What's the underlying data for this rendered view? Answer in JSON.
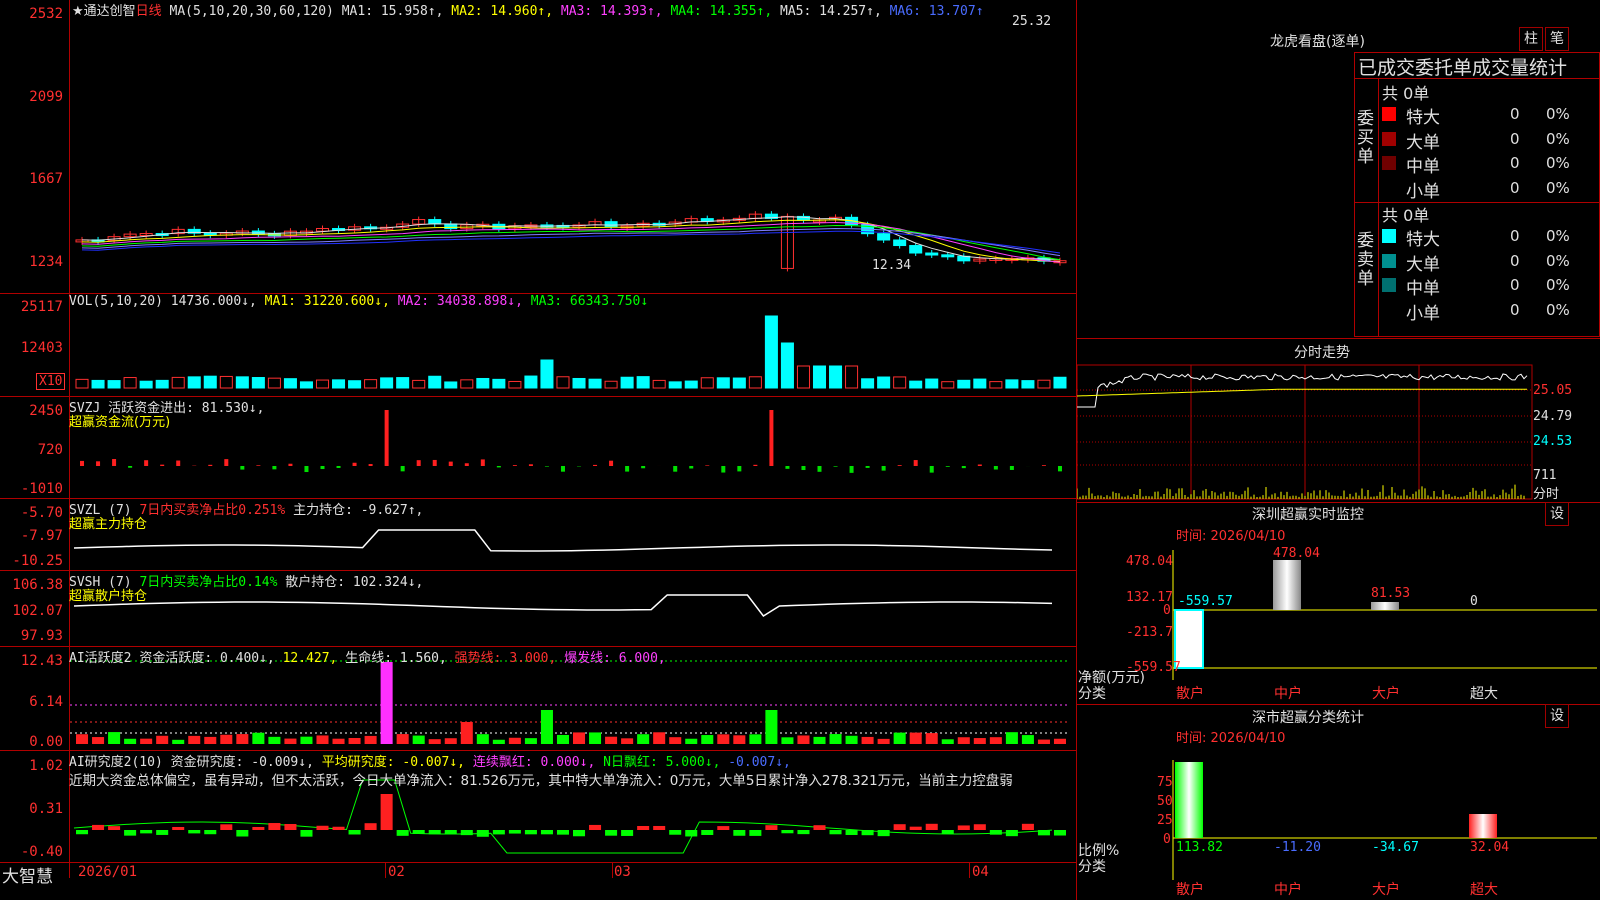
{
  "main": {
    "stock_name": "通达创智",
    "period": "日线",
    "ma_params": "MA(5,10,20,30,60,120)",
    "ma1": "MA1: 15.958↑,",
    "ma2": "MA2: 14.960↑,",
    "ma3": "MA3: 14.393↑,",
    "ma4": "MA4: 14.355↑,",
    "ma5": "MA5: 14.257↑,",
    "ma6": "MA6: 13.707↑",
    "high_label": "25.32",
    "low_label": "12.34",
    "y_ticks": [
      "2532",
      "2099",
      "1667",
      "1234"
    ]
  },
  "vol": {
    "title": "VOL(5,10,20)",
    "value": "14736.000↓,",
    "ma1": "MA1: 31220.600↓,",
    "ma2": "MA2: 34038.898↓,",
    "ma3": "MA3: 66343.750↓",
    "y_ticks": [
      "25117",
      "12403"
    ],
    "unit": "X10"
  },
  "svzj": {
    "title": "SVZJ  活跃资金进出: 81.530↓,",
    "subtitle": "超赢资金流(万元)",
    "y_ticks": [
      "2450",
      "720",
      "-1010"
    ]
  },
  "svzl": {
    "title": "SVZL (7)",
    "pct": "7日内买卖净占比0.251%",
    "holding": "主力持仓: -9.627↑,",
    "subtitle": "超赢主力持仓",
    "y_ticks": [
      "-5.70",
      "-7.97",
      "-10.25"
    ]
  },
  "svsh": {
    "title": "SVSH (7)",
    "pct": "7日内买卖净占比0.14%",
    "holding": "散户持仓: 102.324↓,",
    "subtitle": "超赢散户持仓",
    "y_ticks": [
      "106.38",
      "102.07",
      "97.93"
    ]
  },
  "ai_active": {
    "title": "AI活跃度2",
    "v1": "资金活跃度: 0.400↓,",
    "v2": "12.427,",
    "v3": "生命线: 1.560,",
    "v4": "强势线: 3.000,",
    "v5": "爆发线: 6.000,",
    "y_ticks": [
      "12.43",
      "6.14",
      "0.00"
    ]
  },
  "ai_research": {
    "title": "AI研究度2(10)",
    "v1": "资金研究度: -0.009↓,",
    "v2": "平均研究度: -0.007↓,",
    "v3": "连续飘红: 0.000↓,",
    "v4": "N日飘红: 5.000↓,",
    "v5": "-0.007↓,",
    "note": "近期大资金总体偏空，虽有异动，但不太活跃，今日大单净流入：81.526万元，其中特大单净流入：0万元，大单5日累计净入278.321万元，当前主力控盘弱",
    "y_ticks": [
      "1.02",
      "0.31",
      "-0.40"
    ]
  },
  "xaxis": {
    "brand": "大智慧",
    "labels": [
      "2026/01",
      "02",
      "03",
      "04"
    ]
  },
  "dragon": {
    "title": "龙虎看盘(逐单)",
    "btn1": "柱",
    "btn2": "笔",
    "header": "已成交委托单成交量统计",
    "buy_total": "共 0单",
    "buy_label": "委买单",
    "sell_total": "共 0单",
    "sell_label": "委卖单",
    "buy_rows": [
      {
        "name": "特大",
        "count": "0",
        "pct": "0%",
        "color": "#ff0000"
      },
      {
        "name": "大单",
        "count": "0",
        "pct": "0%",
        "color": "#a00000"
      },
      {
        "name": "中单",
        "count": "0",
        "pct": "0%",
        "color": "#700000"
      },
      {
        "name": "小单",
        "count": "0",
        "pct": "0%",
        "color": "#000000"
      }
    ],
    "sell_rows": [
      {
        "name": "特大",
        "count": "0",
        "pct": "0%",
        "color": "#00ffff"
      },
      {
        "name": "大单",
        "count": "0",
        "pct": "0%",
        "color": "#009090"
      },
      {
        "name": "中单",
        "count": "0",
        "pct": "0%",
        "color": "#007070"
      },
      {
        "name": "小单",
        "count": "0",
        "pct": "0%",
        "color": "#000000"
      }
    ]
  },
  "intraday": {
    "title": "分时走势",
    "ticks": [
      "25.05",
      "24.79",
      "24.53",
      "711"
    ],
    "unit": "分时"
  },
  "sz_monitor": {
    "title": "深圳超赢实时监控",
    "btn": "设",
    "time": "时间: 2026/04/10",
    "y_ticks": [
      "478.04",
      "132.17",
      "0",
      "-213.7",
      "-559.57"
    ],
    "ylabel1": "净额(万元)",
    "ylabel2": "分类",
    "bar_labels": [
      "-559.57",
      "478.04",
      "81.53",
      "0"
    ],
    "categories": [
      "散户",
      "中户",
      "大户",
      "超大"
    ]
  },
  "sz_class": {
    "title": "深市超赢分类统计",
    "btn": "设",
    "time": "时间: 2026/04/10",
    "y_ticks": [
      "75",
      "50",
      "25",
      "0"
    ],
    "ylabel1": "比例%",
    "ylabel2": "分类",
    "values": [
      "113.82",
      "-11.20",
      "-34.67",
      "32.04"
    ],
    "categories": [
      "散户",
      "中户",
      "大户",
      "超大"
    ]
  },
  "colors": {
    "up": "#ff3030",
    "down": "#00ffff",
    "grid": "#b00000"
  }
}
